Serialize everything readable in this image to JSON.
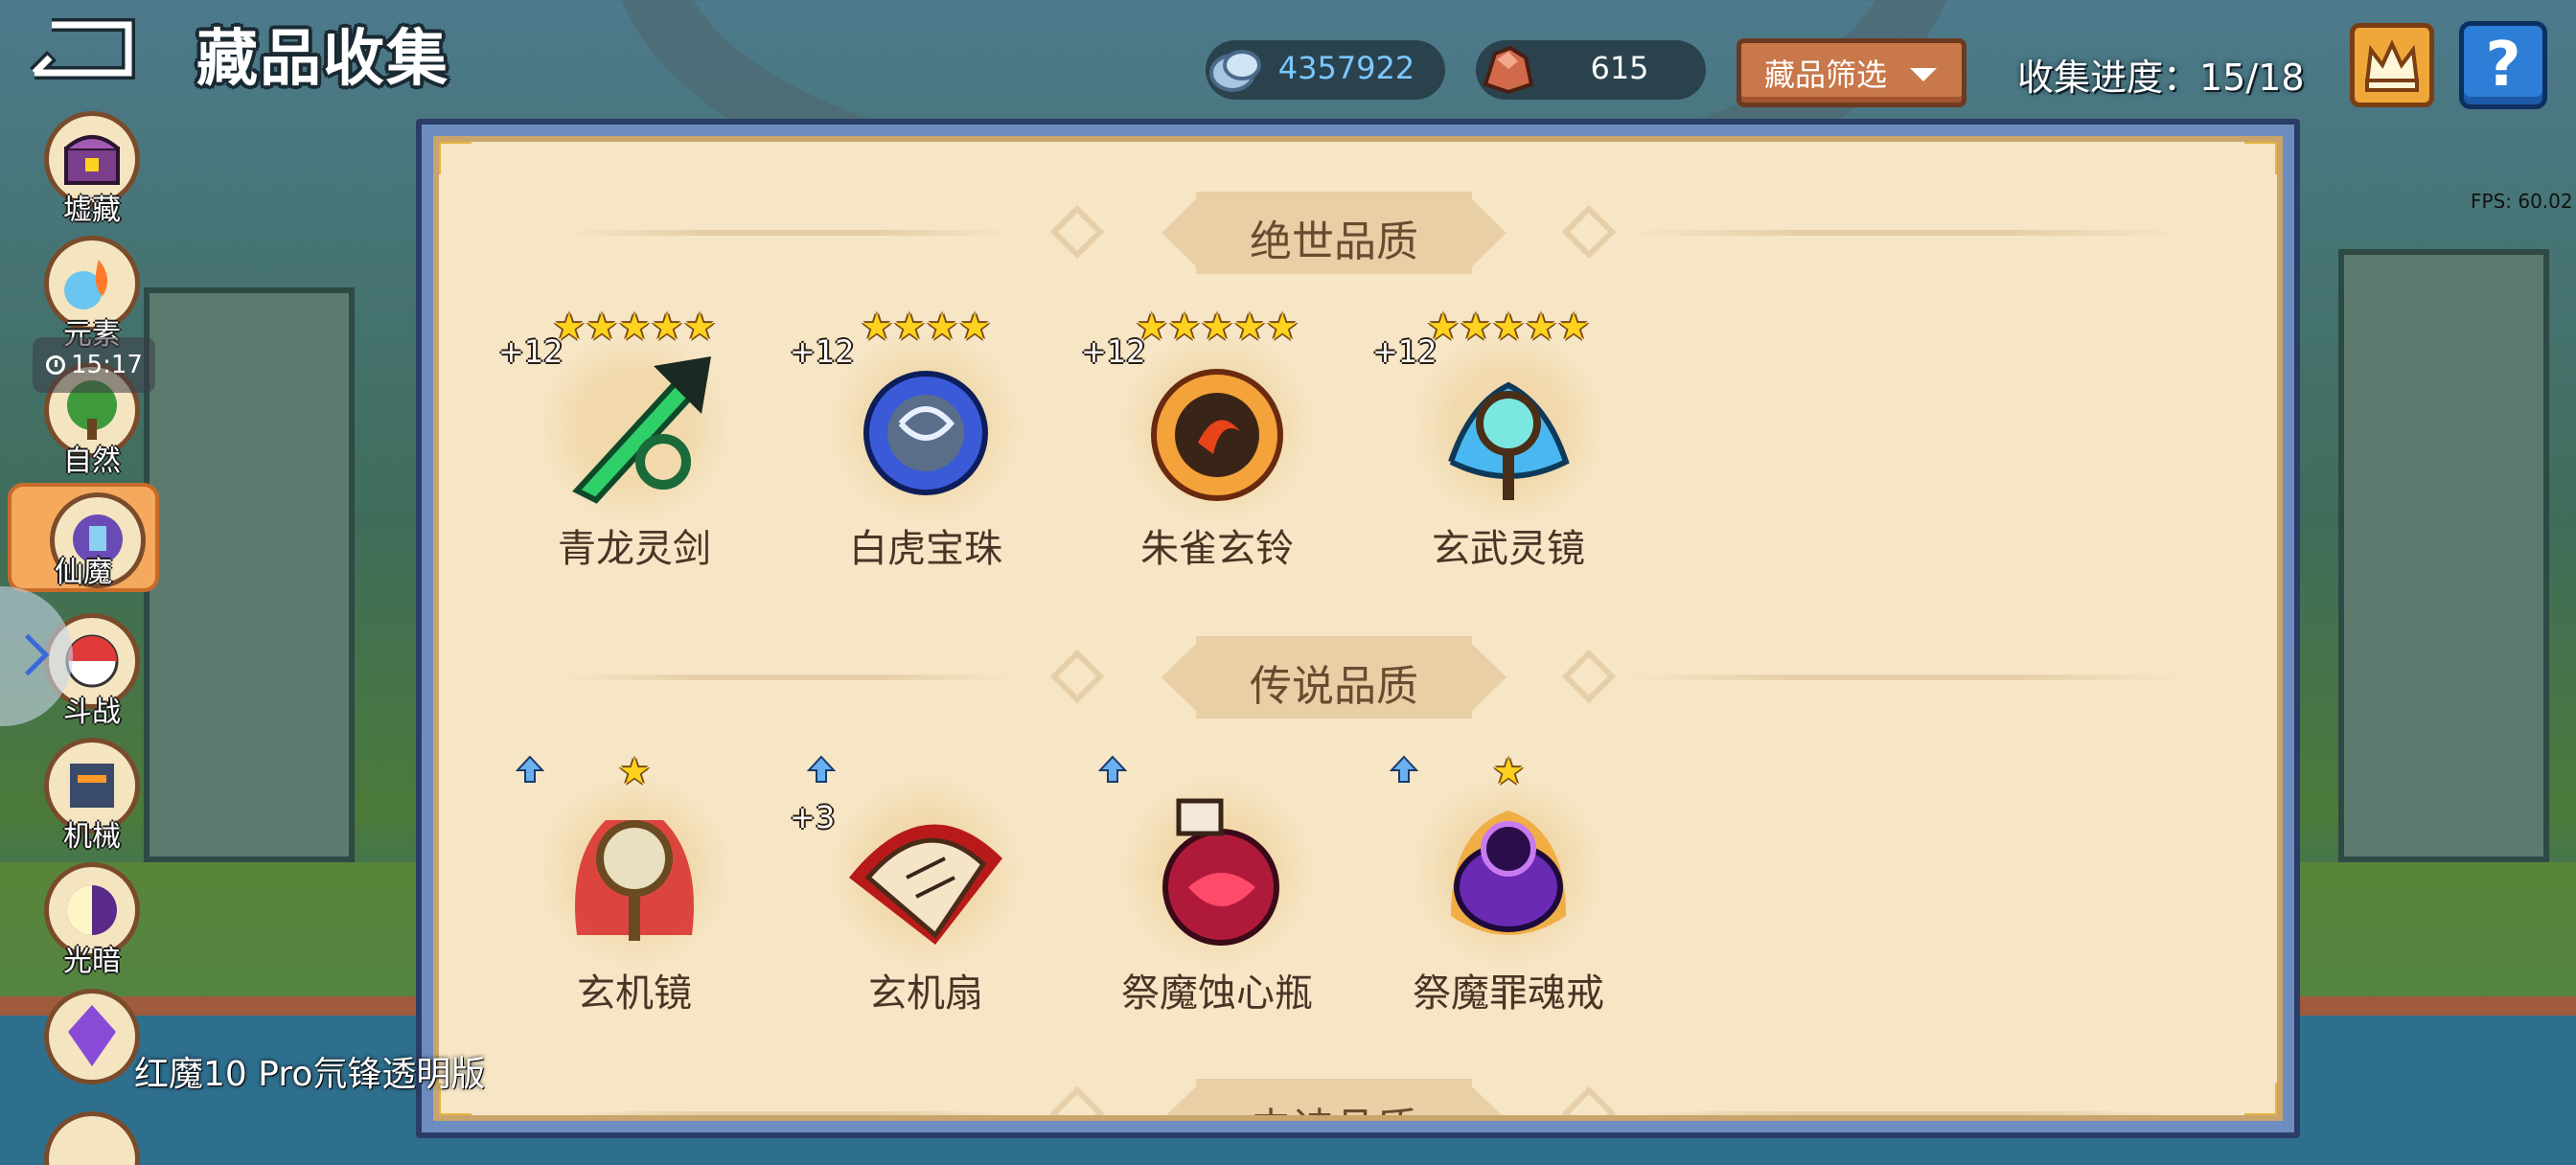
{
  "header": {
    "title": "藏品收集",
    "currency_silver": "4357922",
    "currency_gem": "615",
    "filter_label": "藏品筛选",
    "progress_text": "收集进度：15/18"
  },
  "overlay": {
    "fps": "FPS: 60.02",
    "time": "15:17",
    "device": "红魔10 Pro氘锋透明版"
  },
  "colors": {
    "silver_text": "#7cc8ff",
    "gem_text": "#ffffff",
    "panel_bg": "#f6e6c6",
    "star": "#ffd21f"
  },
  "sidebar": {
    "items": [
      {
        "label": "墟藏",
        "icon": "treasure-chest-icon"
      },
      {
        "label": "元素",
        "icon": "element-orb-icon"
      },
      {
        "label": "自然",
        "icon": "nature-tree-icon"
      },
      {
        "label": "仙魔",
        "icon": "immortal-demon-icon",
        "active": true
      },
      {
        "label": "斗战",
        "icon": "battle-ball-icon"
      },
      {
        "label": "机械",
        "icon": "mech-robot-icon"
      },
      {
        "label": "光暗",
        "icon": "light-dark-icon"
      },
      {
        "label": "",
        "icon": "purple-crystal-icon"
      }
    ]
  },
  "sections": [
    {
      "title": "绝世品质",
      "items": [
        {
          "name": "青龙灵剑",
          "level": "+12",
          "stars": 5,
          "icon": "green-dragon-sword-icon"
        },
        {
          "name": "白虎宝珠",
          "level": "+12",
          "stars": 4,
          "icon": "white-tiger-orb-icon"
        },
        {
          "name": "朱雀玄铃",
          "level": "+12",
          "stars": 5,
          "icon": "vermilion-bell-icon"
        },
        {
          "name": "玄武灵镜",
          "level": "+12",
          "stars": 5,
          "icon": "black-tortoise-mirror-icon"
        }
      ]
    },
    {
      "title": "传说品质",
      "items": [
        {
          "name": "玄机镜",
          "level": "",
          "stars": 1,
          "upgrade": true,
          "icon": "mystic-mirror-icon"
        },
        {
          "name": "玄机扇",
          "level": "+3",
          "stars": 0,
          "upgrade": true,
          "icon": "mystic-fan-icon"
        },
        {
          "name": "祭魔蚀心瓶",
          "level": "",
          "stars": 0,
          "upgrade": true,
          "icon": "demon-potion-icon"
        },
        {
          "name": "祭魔罪魂戒",
          "level": "",
          "stars": 1,
          "upgrade": true,
          "icon": "demon-ring-icon"
        }
      ]
    },
    {
      "title": "史诗品质",
      "items": []
    }
  ]
}
